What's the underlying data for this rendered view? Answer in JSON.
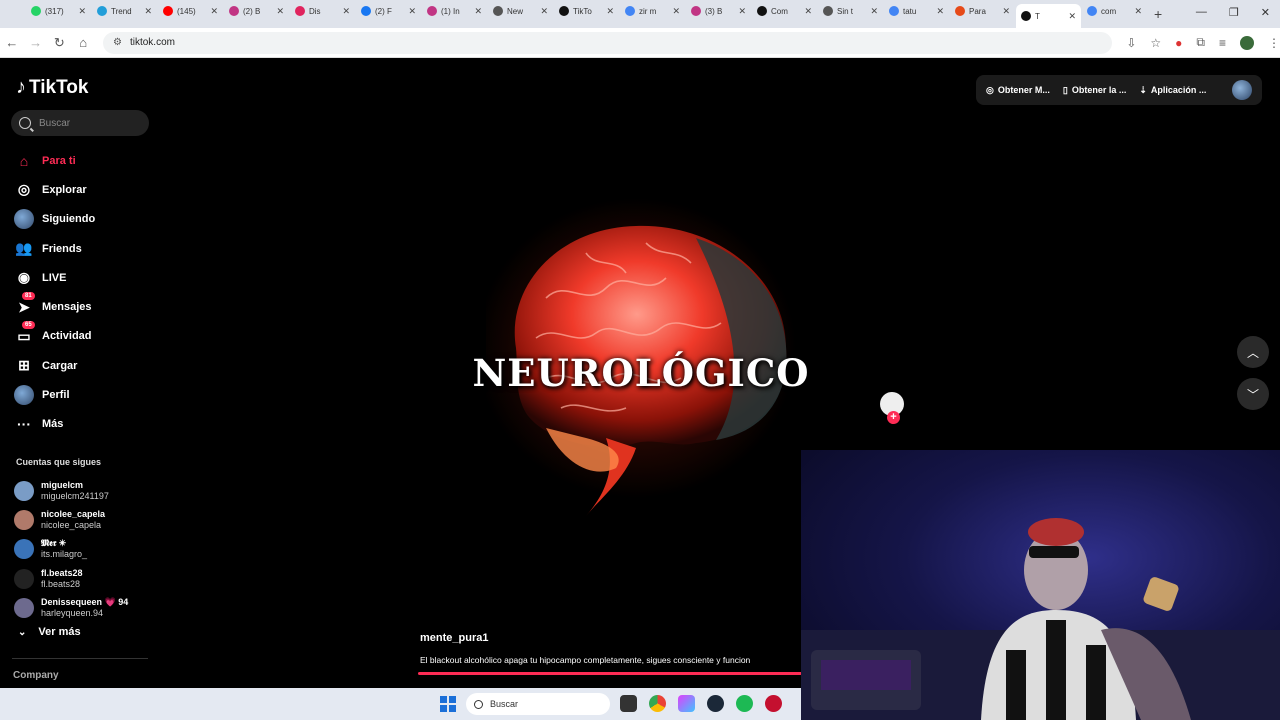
{
  "browser": {
    "tabs": [
      {
        "label": "(317)",
        "color": "#25d366"
      },
      {
        "label": "Trend",
        "color": "#229ed9"
      },
      {
        "label": "(145)",
        "color": "#ff0000"
      },
      {
        "label": "(2) B",
        "color": "#c13584"
      },
      {
        "label": "Dis",
        "color": "#e0245e"
      },
      {
        "label": "(2) F",
        "color": "#1877f2"
      },
      {
        "label": "(1) In",
        "color": "#c13584"
      },
      {
        "label": "New",
        "color": "#555555"
      },
      {
        "label": "TikTo",
        "color": "#111111"
      },
      {
        "label": "zir m",
        "color": "#4285f4"
      },
      {
        "label": "(3) B",
        "color": "#c13584"
      },
      {
        "label": "Com",
        "color": "#111111"
      },
      {
        "label": "Sin t",
        "color": "#555555"
      },
      {
        "label": "tatu",
        "color": "#4285f4"
      },
      {
        "label": "Para",
        "color": "#e64a19"
      },
      {
        "label": "T",
        "color": "#111111",
        "active": true
      },
      {
        "label": "com",
        "color": "#4285f4"
      }
    ],
    "url": "tiktok.com"
  },
  "tiktok": {
    "logo": "TikTok",
    "search_placeholder": "Buscar",
    "nav": [
      {
        "label": "Para ti",
        "icon": "home-icon",
        "active": true
      },
      {
        "label": "Explorar",
        "icon": "compass-icon"
      },
      {
        "label": "Siguiendo",
        "icon": "following-avatar"
      },
      {
        "label": "Friends",
        "icon": "friends-icon"
      },
      {
        "label": "LIVE",
        "icon": "live-icon"
      },
      {
        "label": "Mensajes",
        "icon": "messages-icon",
        "badge": "81"
      },
      {
        "label": "Actividad",
        "icon": "activity-icon",
        "badge": "65"
      },
      {
        "label": "Cargar",
        "icon": "upload-icon"
      },
      {
        "label": "Perfil",
        "icon": "profile-avatar"
      },
      {
        "label": "Más",
        "icon": "more-icon"
      }
    ],
    "following_title": "Cuentas que sigues",
    "following": [
      {
        "name": "miguelcm",
        "handle": "miguelcm241197",
        "color": "#7a9cc6"
      },
      {
        "name": "nicolee_capela",
        "handle": "nicolee_capela",
        "color": "#b07a6a"
      },
      {
        "name": "𝕸𝖊𝖗 ✴",
        "handle": "its.milagro_",
        "color": "#3a73b8"
      },
      {
        "name": "fl.beats28",
        "handle": "fl.beats28",
        "color": "#222222"
      },
      {
        "name": "Denissequeen 💗 94",
        "handle": "harleyqueen.94",
        "color": "#6d6a8e"
      }
    ],
    "see_more": "Ver más",
    "company": "Company",
    "header_buttons": [
      {
        "label": "Obtener M...",
        "icon": "coin-icon"
      },
      {
        "label": "Obtener la ...",
        "icon": "phone-icon"
      },
      {
        "label": "Aplicación ...",
        "icon": "download-icon"
      }
    ],
    "video": {
      "overlay_text": "NEUROLÓGICO",
      "author": "mente_pura1",
      "caption": "El blackout alcohólico apaga tu hipocampo completamente, sigues consciente y funcion",
      "progress": 1.0
    }
  },
  "taskbar": {
    "search_placeholder": "Buscar"
  }
}
